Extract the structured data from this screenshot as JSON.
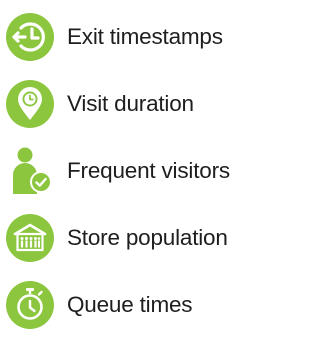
{
  "features": [
    {
      "label": "Exit timestamps",
      "icon": "exit-clock-icon"
    },
    {
      "label": "Visit duration",
      "icon": "location-pin-clock-icon"
    },
    {
      "label": "Frequent visitors",
      "icon": "person-check-icon"
    },
    {
      "label": "Store population",
      "icon": "store-people-icon"
    },
    {
      "label": "Queue times",
      "icon": "stopwatch-icon"
    }
  ],
  "colors": {
    "accent": "#8cc63f",
    "text": "#1e1e1e"
  }
}
